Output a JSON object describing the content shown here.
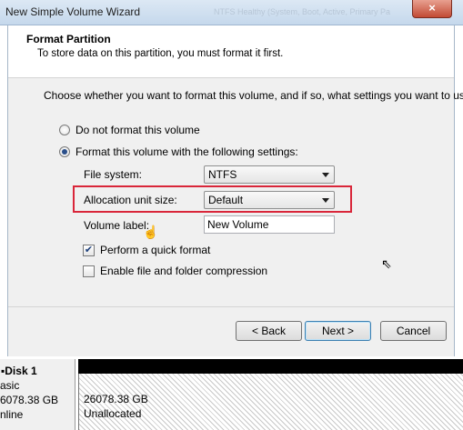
{
  "window": {
    "title": "New Simple Volume Wizard",
    "close_glyph": "×",
    "faint_background_text": "NTFS        Healthy (System, Boot, Active, Primary Pa"
  },
  "header": {
    "title": "Format Partition",
    "subtitle": "To store data on this partition, you must format it first."
  },
  "intro": "Choose whether you want to format this volume, and if so, what settings you want to use.",
  "options": {
    "no_format_label": "Do not format this volume",
    "format_label": "Format this volume with the following settings:",
    "selected": "format"
  },
  "settings": {
    "file_system_label": "File system:",
    "file_system_value": "NTFS",
    "allocation_label": "Allocation unit size:",
    "allocation_value": "Default",
    "volume_label_label": "Volume label:",
    "volume_label_value": "New Volume",
    "quick_format_label": "Perform a quick format",
    "quick_format_checked": true,
    "compression_label": "Enable file and folder compression",
    "compression_checked": false
  },
  "buttons": {
    "back": "< Back",
    "next": "Next >",
    "cancel": "Cancel"
  },
  "disk": {
    "name": "Disk 1",
    "type": "asic",
    "size": "6078.38 GB",
    "status": "nline",
    "partition_size": "26078.38 GB",
    "partition_status": "Unallocated"
  },
  "colors": {
    "highlight_border": "#d9263a",
    "dialog_bg": "#f0f0f0"
  }
}
